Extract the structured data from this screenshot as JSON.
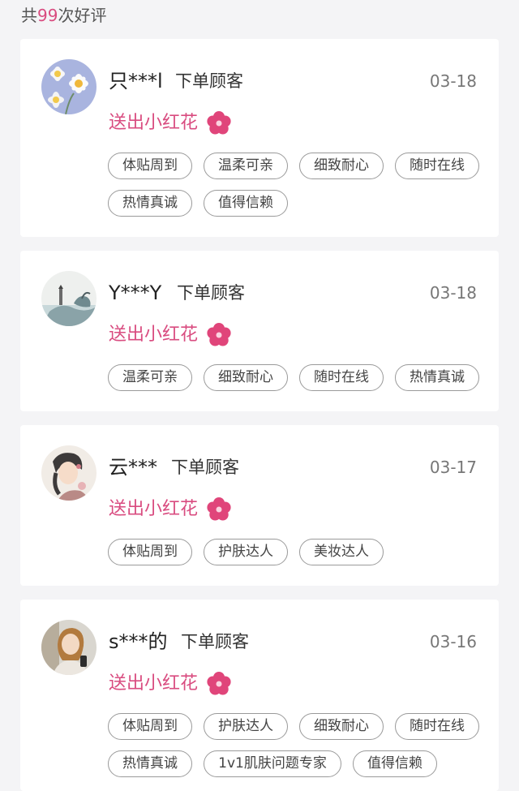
{
  "summary": {
    "prefix": "共",
    "count": "99",
    "suffix": "次好评"
  },
  "flower_color": "#d94c80",
  "reviews": [
    {
      "username": "只***l",
      "role": "下单顾客",
      "date": "03-18",
      "gift_text": "送出小红花",
      "avatar_icon": "daisy-avatar",
      "tags": [
        "体贴周到",
        "温柔可亲",
        "细致耐心",
        "随时在线",
        "热情真诚",
        "值得信赖"
      ]
    },
    {
      "username": "Y***Y",
      "role": "下单顾客",
      "date": "03-18",
      "gift_text": "送出小红花",
      "avatar_icon": "lighthouse-painting-avatar",
      "tags": [
        "温柔可亲",
        "细致耐心",
        "随时在线",
        "热情真诚"
      ]
    },
    {
      "username": "云***",
      "role": "下单顾客",
      "date": "03-17",
      "gift_text": "送出小红花",
      "avatar_icon": "illustrated-girl-avatar",
      "tags": [
        "体贴周到",
        "护肤达人",
        "美妆达人"
      ]
    },
    {
      "username": "s***的",
      "role": "下单顾客",
      "date": "03-16",
      "gift_text": "送出小红花",
      "avatar_icon": "photo-woman-avatar",
      "tags": [
        "体贴周到",
        "护肤达人",
        "细致耐心",
        "随时在线",
        "热情真诚",
        "1v1肌肤问题专家",
        "值得信赖"
      ]
    }
  ]
}
